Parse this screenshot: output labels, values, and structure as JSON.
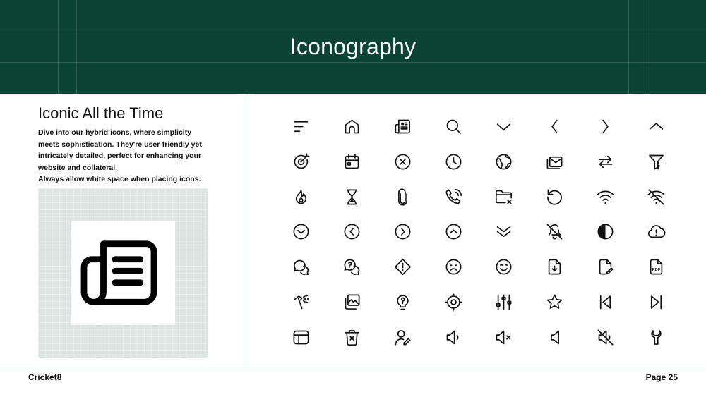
{
  "header": {
    "title": "Iconography"
  },
  "section": {
    "heading": "Iconic All the Time",
    "body": "Dive into our hybrid icons, where simplicity meets sophistication. They're user-friendly yet intricately detailed, perfect for enhancing your website and collateral.",
    "note": "Always allow white space when placing icons."
  },
  "preview": {
    "icon": "newspaper-icon"
  },
  "icons": [
    "menu-lines-icon",
    "home-icon",
    "newspaper-icon",
    "search-icon",
    "chevron-down-icon",
    "chevron-left-icon",
    "chevron-right-icon",
    "chevron-up-icon",
    "target-icon",
    "calendar-icon",
    "close-circle-icon",
    "clock-icon",
    "globe-icon",
    "mail-stack-icon",
    "swap-arrows-icon",
    "filter-bolt-icon",
    "flame-icon",
    "hourglass-icon",
    "paperclip-icon",
    "phone-ringing-icon",
    "folder-remove-icon",
    "refresh-icon",
    "wifi-icon",
    "wifi-off-icon",
    "chevron-down-circle-icon",
    "chevron-left-circle-icon",
    "chevron-right-circle-icon",
    "chevron-up-circle-icon",
    "chevrons-down-icon",
    "bell-off-icon",
    "contrast-icon",
    "cloud-alert-icon",
    "chat-bubbles-icon",
    "help-chat-icon",
    "alert-diamond-icon",
    "sad-face-icon",
    "smile-face-icon",
    "file-download-icon",
    "file-edit-icon",
    "pdf-file-icon",
    "hammer-icon",
    "image-gallery-icon",
    "lightbulb-question-icon",
    "crosshair-icon",
    "sliders-icon",
    "star-icon",
    "skip-back-icon",
    "skip-forward-icon",
    "layout-window-icon",
    "trash-x-icon",
    "user-edit-icon",
    "speaker-icon",
    "speaker-mute-icon",
    "speaker-low-icon",
    "speaker-off-icon",
    "wrench-icon"
  ],
  "icon_labels": {
    "pdf": "PDF"
  },
  "footer": {
    "brand": "Cricket8",
    "page": "Page 25"
  },
  "colors": {
    "header_bg": "#0b4334",
    "divider": "#2f5b4d",
    "preview_bg": "#dce5e1"
  }
}
